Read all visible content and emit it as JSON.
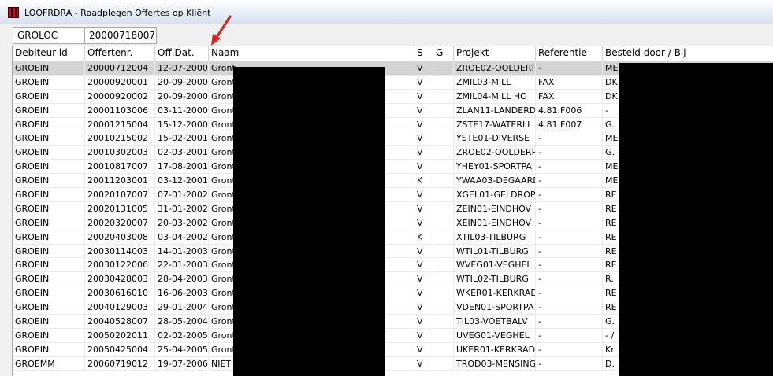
{
  "window": {
    "title": "LOOFRDRA - Raadplegen Offertes op Kliënt"
  },
  "filter": {
    "code": "GROLOC",
    "client_id": "20000718007"
  },
  "table": {
    "columns": [
      "Debiteur-id",
      "Offertenr.",
      "Off.Dat.",
      "Naam",
      "S",
      "G",
      "Projekt",
      "Referentie",
      "Besteld door / Bij"
    ],
    "selected_row": 0,
    "rows": [
      [
        "GROEIN",
        "20000712004",
        "12-07-2000",
        "Gront",
        "V",
        "",
        "ZROE02-OOLDERP",
        "-",
        "ME"
      ],
      [
        "GROEIN",
        "20000920001",
        "20-09-2000",
        "Gront",
        "V",
        "",
        "ZMIL03-MILL",
        "FAX",
        "DK"
      ],
      [
        "GROEIN",
        "20000920002",
        "20-09-2000",
        "Gront",
        "V",
        "",
        "ZMIL04-MILL HO",
        "FAX",
        "DK"
      ],
      [
        "GROEIN",
        "20001103006",
        "03-11-2000",
        "Gront",
        "V",
        "",
        "ZLAN11-LANDERD",
        "4.81.F006",
        "-"
      ],
      [
        "GROEIN",
        "20001215004",
        "15-12-2000",
        "Gront",
        "V",
        "",
        "ZSTE17-WATERLI",
        "4.81.F007",
        "G."
      ],
      [
        "GROEIN",
        "20010215002",
        "15-02-2001",
        "Gront",
        "V",
        "",
        "YSTE01-DIVERSE",
        "-",
        "ME"
      ],
      [
        "GROEIN",
        "20010302003",
        "02-03-2001",
        "Gront",
        "V",
        "",
        "ZROE02-OOLDERP",
        "-",
        "G."
      ],
      [
        "GROEIN",
        "20010817007",
        "17-08-2001",
        "Gront",
        "V",
        "",
        "YHEY01-SPORTPA",
        "-",
        "ME"
      ],
      [
        "GROEIN",
        "20011203001",
        "03-12-2001",
        "Gront",
        "K",
        "",
        "YWAA03-DEGAARD",
        "-",
        "ME"
      ],
      [
        "GROEIN",
        "20020107007",
        "07-01-2002",
        "Gront",
        "V",
        "",
        "XGEL01-GELDROP",
        "-",
        "RE"
      ],
      [
        "GROEIN",
        "20020131005",
        "31-01-2002",
        "Gront",
        "V",
        "",
        "ZEIN01-EINDHOV",
        "-",
        "RE"
      ],
      [
        "GROEIN",
        "20020320007",
        "20-03-2002",
        "Gront",
        "V",
        "",
        "XEIN01-EINDHOV",
        "-",
        "RE"
      ],
      [
        "GROEIN",
        "20020403008",
        "03-04-2002",
        "Gront",
        "K",
        "",
        "XTIL03-TILBURG",
        "-",
        "RE"
      ],
      [
        "GROEIN",
        "20030114003",
        "14-01-2003",
        "Gront",
        "V",
        "",
        "WTIL01-TILBURG",
        "-",
        "RE"
      ],
      [
        "GROEIN",
        "20030122006",
        "22-01-2003",
        "Gront",
        "V",
        "",
        "WVEG01-VEGHEL",
        "-",
        "RE"
      ],
      [
        "GROEIN",
        "20030428003",
        "28-04-2003",
        "Gront",
        "V",
        "",
        "WTIL02-TILBURG",
        "-",
        "R."
      ],
      [
        "GROEIN",
        "20030616010",
        "16-06-2003",
        "Gront",
        "V",
        "",
        "WKER01-KERKRAD",
        "-",
        "RE"
      ],
      [
        "GROEIN",
        "20040129003",
        "29-01-2004",
        "Gront",
        "V",
        "",
        "VDEN01-SPORTPA",
        "-",
        "RE"
      ],
      [
        "GROEIN",
        "20040528007",
        "28-05-2004",
        "Gront",
        "V",
        "",
        "TIL03-VOETBALV",
        "-",
        "G."
      ],
      [
        "GROEIN",
        "20050202011",
        "02-02-2005",
        "Gront",
        "V",
        "",
        "UVEG01-VEGHEL",
        "-",
        "- /"
      ],
      [
        "GROEIN",
        "20050425004",
        "25-04-2005",
        "Gront",
        "V",
        "",
        "UKER01-KERKRAD",
        "-",
        "Kr"
      ],
      [
        "GROEMM",
        "20060719012",
        "19-07-2006",
        "NIET",
        "V",
        "",
        "TROD03-MENSING",
        "-",
        "D."
      ]
    ]
  },
  "colors": {
    "arrow": "#e0201b",
    "selection": "#d4d4d4",
    "redaction": "#000000"
  }
}
